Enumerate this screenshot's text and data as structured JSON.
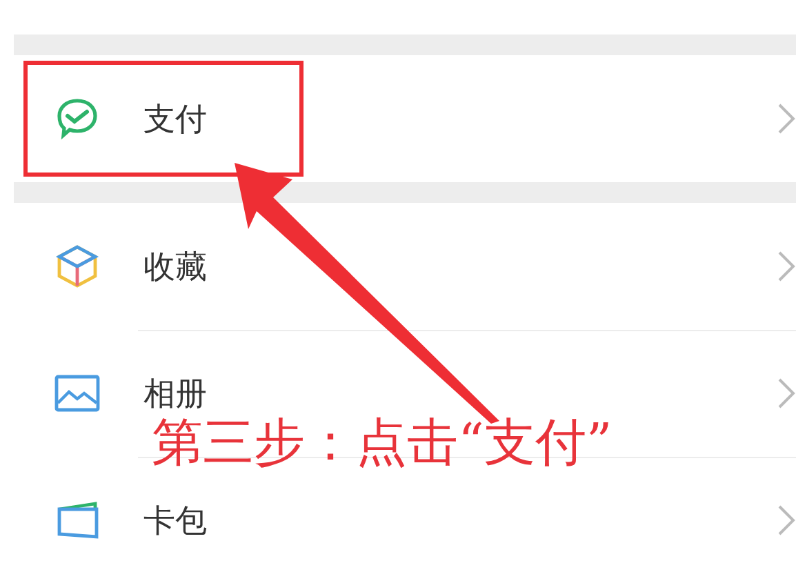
{
  "sections": [
    {
      "items": [
        {
          "kind": "pay",
          "label": "支付",
          "highlighted": true
        }
      ]
    },
    {
      "items": [
        {
          "kind": "box",
          "label": "收藏",
          "highlighted": false
        },
        {
          "kind": "image",
          "label": "相册",
          "highlighted": false
        },
        {
          "kind": "card",
          "label": "卡包",
          "highlighted": false
        }
      ]
    }
  ],
  "annotation": {
    "text": "第三步：点击“支付”"
  }
}
